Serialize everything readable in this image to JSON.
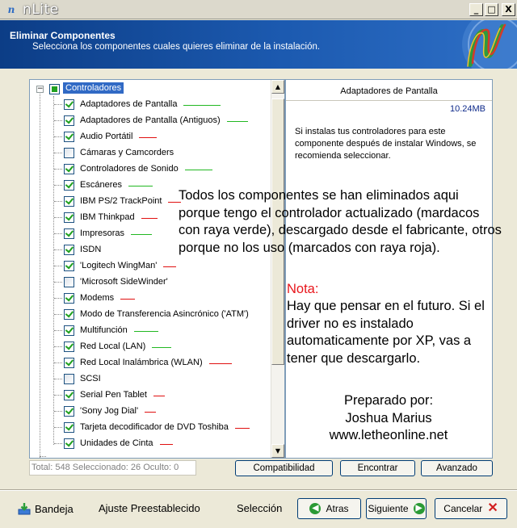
{
  "window": {
    "title": "nLite",
    "buttons": [
      "_",
      "□",
      "X"
    ]
  },
  "header": {
    "title": "Eliminar Componentes",
    "subtitle": "Selecciona los componentes cuales quieres eliminar de la instalación."
  },
  "tree": {
    "root_label": "Controladores",
    "items": [
      {
        "label": "Adaptadores de Pantalla",
        "checked": true,
        "mark": "green"
      },
      {
        "label": "Adaptadores de Pantalla (Antiguos)",
        "checked": true,
        "mark": "green"
      },
      {
        "label": "Audio Portátil",
        "checked": true,
        "mark": "red"
      },
      {
        "label": "Cámaras y Camcorders",
        "checked": false,
        "mark": ""
      },
      {
        "label": "Controladores de Sonido",
        "checked": true,
        "mark": "green"
      },
      {
        "label": "Escáneres",
        "checked": true,
        "mark": "green"
      },
      {
        "label": "IBM PS/2 TrackPoint",
        "checked": true,
        "mark": "red"
      },
      {
        "label": "IBM Thinkpad",
        "checked": true,
        "mark": "red"
      },
      {
        "label": "Impresoras",
        "checked": true,
        "mark": "green"
      },
      {
        "label": "ISDN",
        "checked": true,
        "mark": ""
      },
      {
        "label": "'Logitech WingMan'",
        "checked": true,
        "mark": "red"
      },
      {
        "label": "'Microsoft SideWinder'",
        "checked": false,
        "mark": ""
      },
      {
        "label": "Modems",
        "checked": true,
        "mark": "red"
      },
      {
        "label": "Modo de Transferencia Asincrónico ('ATM')",
        "checked": true,
        "mark": ""
      },
      {
        "label": "Multifunción",
        "checked": true,
        "mark": "green"
      },
      {
        "label": "Red Local (LAN)",
        "checked": true,
        "mark": "green"
      },
      {
        "label": "Red Local Inalámbrica (WLAN)",
        "checked": true,
        "mark": "red"
      },
      {
        "label": "SCSI",
        "checked": false,
        "mark": ""
      },
      {
        "label": "Serial Pen Tablet",
        "checked": true,
        "mark": "red"
      },
      {
        "label": "'Sony Jog Dial'",
        "checked": true,
        "mark": "red"
      },
      {
        "label": "Tarjeta decodificador de DVD Toshiba",
        "checked": true,
        "mark": "red"
      },
      {
        "label": "Unidades de Cinta",
        "checked": true,
        "mark": "red"
      }
    ]
  },
  "info": {
    "heading": "Adaptadores de Pantalla",
    "size": "10.24MB",
    "description": "Si instalas tus controladores para este componente después de instalar Windows, se recomienda seleccionar."
  },
  "annotations": {
    "main": "Todos los componentes se han eliminados aqui porque tengo el controlador actualizado (mardacos con raya verde), descargado desde el fabricante, otros porque no los uso (marcados con raya roja).",
    "nota_label": "Nota:",
    "nota_body": "Hay que pensar en el futuro. Si el driver no es instalado automaticamente por XP, vas a tener que descargarlo.",
    "credit_line1": "Preparado por:",
    "credit_line2": "Joshua Marius",
    "credit_line3": "www.letheonline.net"
  },
  "status": {
    "text": "Total: 548 Seleccionado: 26 Oculto: 0"
  },
  "buttons": {
    "compat": "Compatibilidad",
    "find": "Encontrar",
    "advanced": "Avanzado"
  },
  "footer": {
    "bandeja": "Bandeja",
    "ajuste": "Ajuste Preestablecido",
    "seleccion": "Selección",
    "atras": "Atras",
    "siguiente": "Siguiente",
    "cancelar": "Cancelar"
  },
  "colors": {
    "accent": "#316ac5",
    "header_bg": "#1c5ab0",
    "mark_green": "#22b822",
    "mark_red": "#e01010",
    "nota": "#e8151b"
  }
}
